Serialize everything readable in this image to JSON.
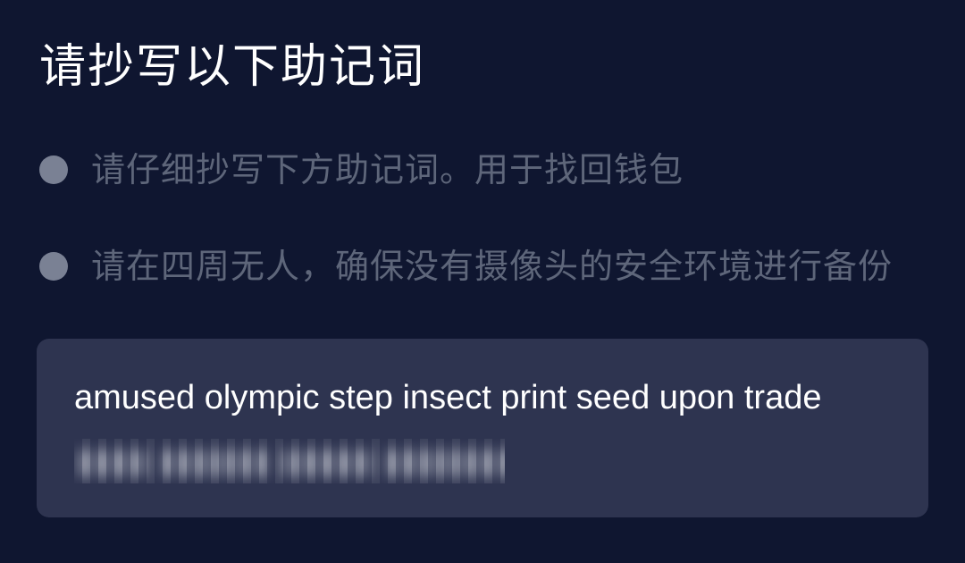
{
  "page": {
    "title": "请抄写以下助记词"
  },
  "tips": [
    {
      "text": "请仔细抄写下方助记词。用于找回钱包"
    },
    {
      "text": "请在四周无人，确保没有摄像头的安全环境进行备份"
    }
  ],
  "mnemonic": {
    "visible_line": "amused olympic step insect print seed upon trade",
    "hidden_line": "",
    "hidden_line_redacted": true
  },
  "colors": {
    "background": "#0f1630",
    "card": "#2e3450",
    "title_text": "#ffffff",
    "tip_text": "#5e667a",
    "bullet": "#7a8194",
    "mnemonic_text": "#ffffff"
  }
}
